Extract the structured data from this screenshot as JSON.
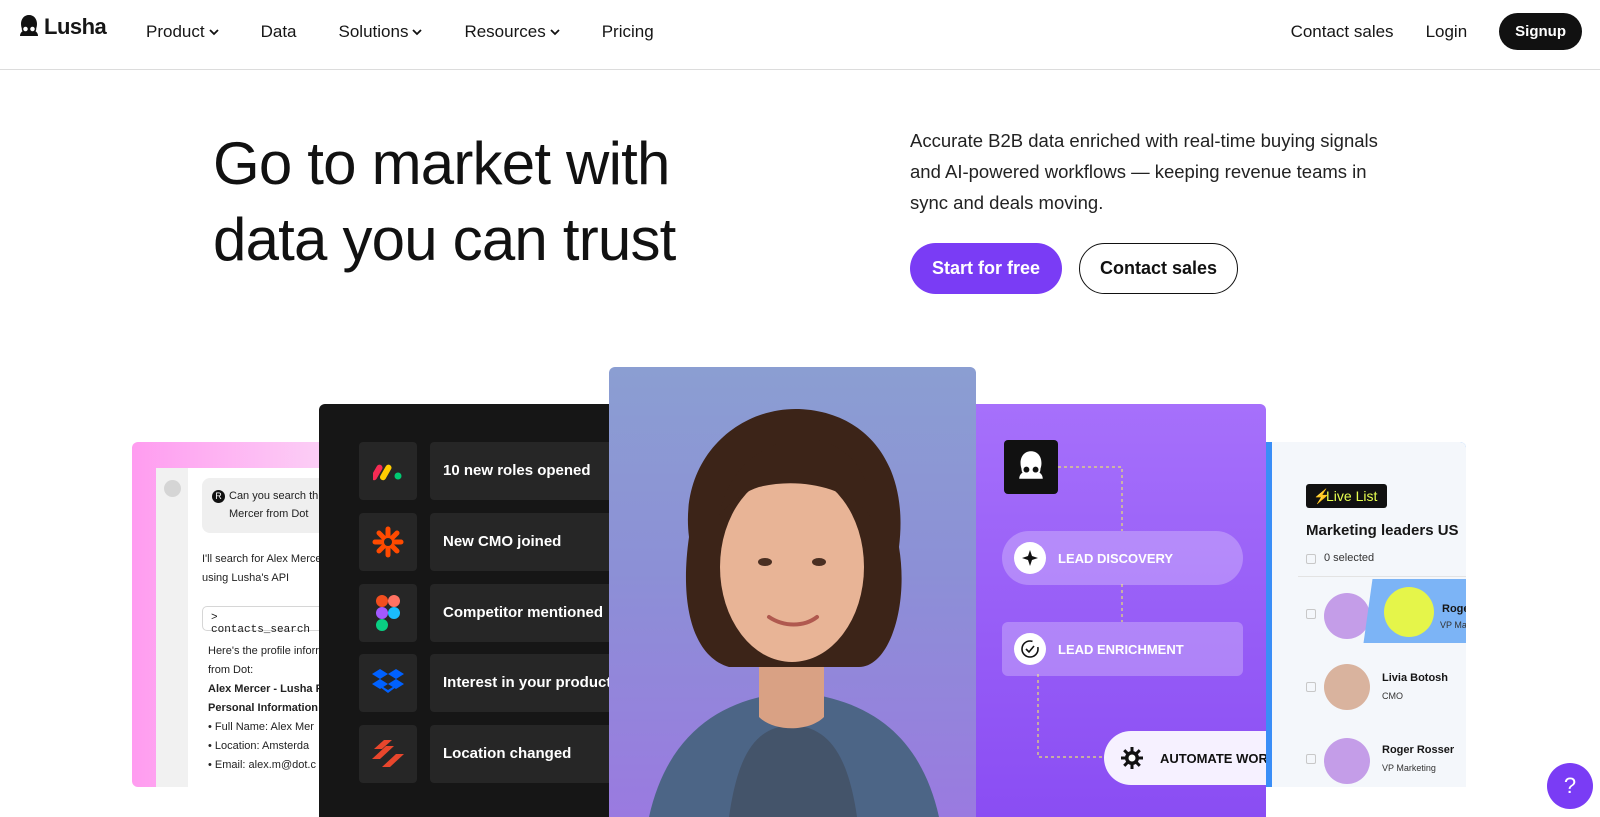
{
  "nav": {
    "logo_text": "Lusha",
    "links": [
      {
        "label": "Product",
        "dropdown": true
      },
      {
        "label": "Data",
        "dropdown": false
      },
      {
        "label": "Solutions",
        "dropdown": true
      },
      {
        "label": "Resources",
        "dropdown": true
      },
      {
        "label": "Pricing",
        "dropdown": false
      }
    ],
    "contact_sales": "Contact sales",
    "login": "Login",
    "signup": "Signup"
  },
  "hero": {
    "headline_line1": "Go to market with",
    "headline_line2": "data you can trust",
    "description": "Accurate B2B data enriched with real-time buying signals and AI-powered workflows — keeping revenue teams in sync and deals moving.",
    "primary_cta": "Start for free",
    "secondary_cta": "Contact sales"
  },
  "chat_card": {
    "user_badge": "R",
    "user_message": "Can you search th Mercer from Dot",
    "user_line1": "Can you search th",
    "user_line2": "Mercer from Dot",
    "reply_line1": "I'll search for Alex Merce",
    "reply_line2": "using Lusha's API",
    "command": "> contacts_search",
    "result_line1": "Here's the profile inforr",
    "result_line2": "from Dot:",
    "result_line3": "Alex Mercer - Lusha P",
    "result_line4": "Personal Information:",
    "bullets": [
      "Full Name: Alex Mer",
      "Location: Amsterda",
      "Email: alex.m@dot.c"
    ]
  },
  "signals_card": {
    "items": [
      {
        "label": "10 new roles opened",
        "icon": "monday-logo-icon"
      },
      {
        "label": "New CMO joined",
        "icon": "zapier-logo-icon"
      },
      {
        "label": "Competitor mentioned",
        "icon": "figma-logo-icon"
      },
      {
        "label": "Interest in your  product",
        "icon": "dropbox-logo-icon"
      },
      {
        "label": "Location changed",
        "icon": "stack-logo-icon"
      }
    ]
  },
  "workflow_card": {
    "steps": [
      "LEAD DISCOVERY",
      "LEAD ENRICHMENT",
      "AUTOMATE WOR"
    ]
  },
  "live_list_card": {
    "badge": "Live List",
    "title": "Marketing leaders US",
    "selected": "0 selected",
    "people": [
      {
        "name": "Roge",
        "role": "VP Mar"
      },
      {
        "name": "Livia Botosh",
        "role": "CMO"
      },
      {
        "name": "Roger Rosser",
        "role": "VP Marketing"
      }
    ]
  },
  "help_button": "?",
  "colors": {
    "accent": "#7a3cf5",
    "dark": "#111111",
    "live_yellow": "#e8ff50"
  }
}
